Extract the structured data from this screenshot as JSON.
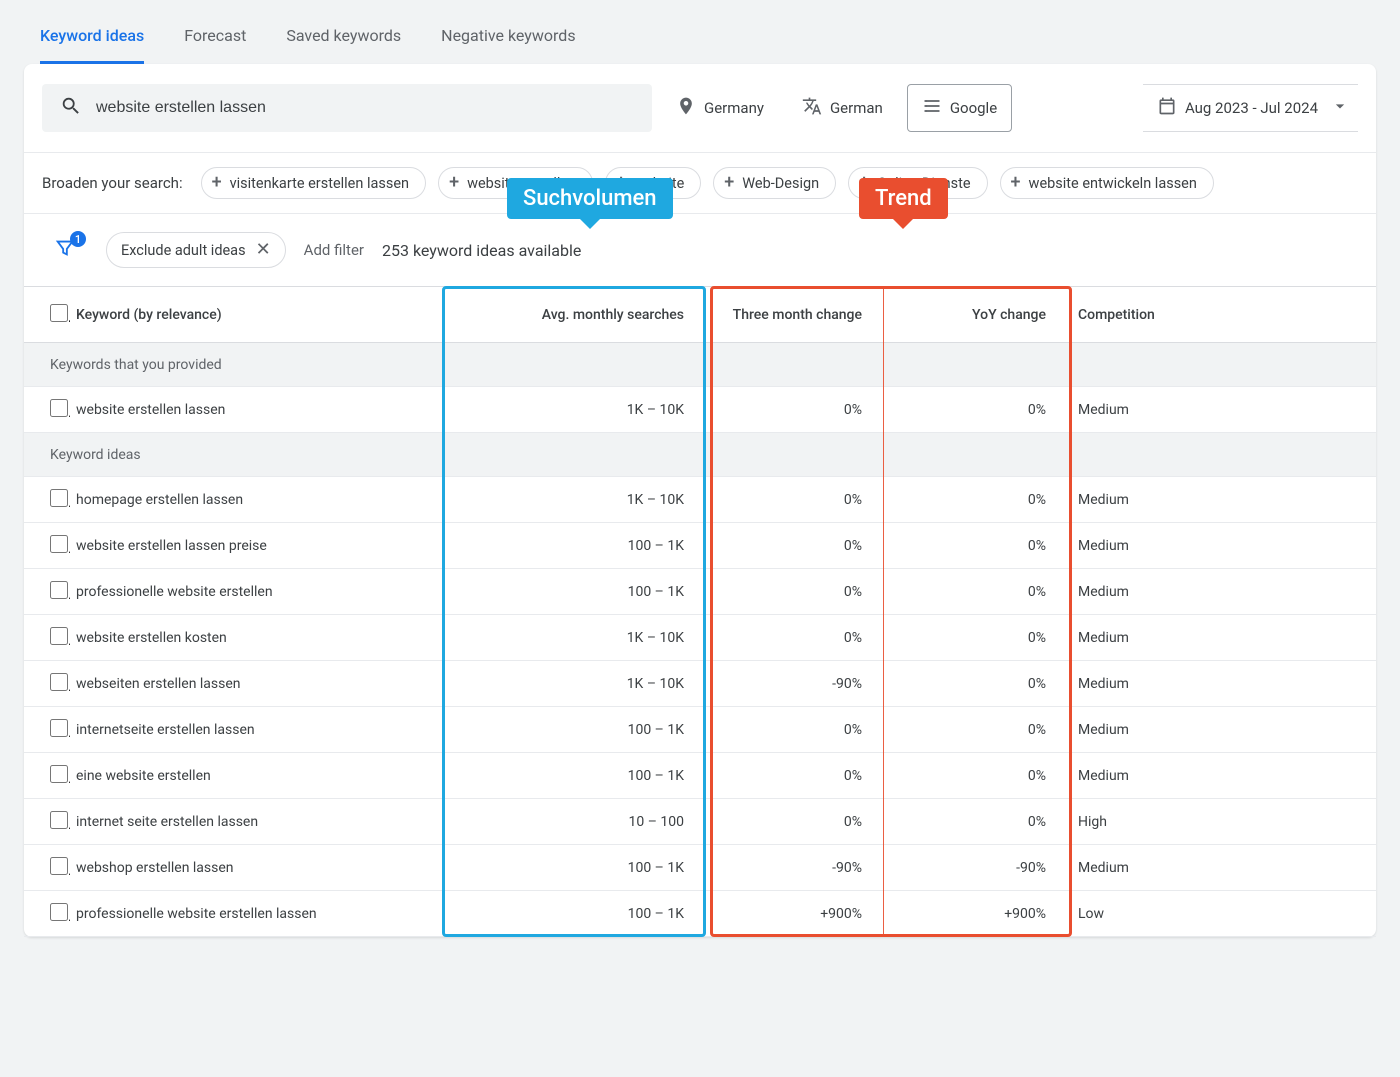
{
  "tabs": {
    "items": [
      {
        "label": "Keyword ideas",
        "active": true
      },
      {
        "label": "Forecast",
        "active": false
      },
      {
        "label": "Saved keywords",
        "active": false
      },
      {
        "label": "Negative keywords",
        "active": false
      }
    ]
  },
  "search": {
    "query": "website erstellen lassen",
    "location": "Germany",
    "language": "German",
    "network": "Google",
    "daterange": "Aug 2023 - Jul 2024"
  },
  "broaden": {
    "label": "Broaden your search:",
    "suggestions": [
      "visitenkarte erstellen lassen",
      "website erstellen",
      "website",
      "Web-Design",
      "Online-Dienste",
      "website entwickeln lassen"
    ]
  },
  "filters": {
    "badge": "1",
    "chip": "Exclude adult ideas",
    "add": "Add filter",
    "available": "253 keyword ideas available"
  },
  "annotations": {
    "volume": "Suchvolumen",
    "trend": "Trend"
  },
  "table": {
    "headers": {
      "keyword": "Keyword (by relevance)",
      "avg": "Avg. monthly searches",
      "three_mo": "Three month change",
      "yoy": "YoY change",
      "comp": "Competition"
    },
    "section_provided": "Keywords that you provided",
    "provided": [
      {
        "kw": "website erstellen lassen",
        "avg": "1K – 10K",
        "three_mo": "0%",
        "yoy": "0%",
        "comp": "Medium"
      }
    ],
    "section_ideas": "Keyword ideas",
    "ideas": [
      {
        "kw": "homepage erstellen lassen",
        "avg": "1K – 10K",
        "three_mo": "0%",
        "yoy": "0%",
        "comp": "Medium"
      },
      {
        "kw": "website erstellen lassen preise",
        "avg": "100 – 1K",
        "three_mo": "0%",
        "yoy": "0%",
        "comp": "Medium"
      },
      {
        "kw": "professionelle website erstellen",
        "avg": "100 – 1K",
        "three_mo": "0%",
        "yoy": "0%",
        "comp": "Medium"
      },
      {
        "kw": "website erstellen kosten",
        "avg": "1K – 10K",
        "three_mo": "0%",
        "yoy": "0%",
        "comp": "Medium"
      },
      {
        "kw": "webseiten erstellen lassen",
        "avg": "1K – 10K",
        "three_mo": "-90%",
        "yoy": "0%",
        "comp": "Medium"
      },
      {
        "kw": "internetseite erstellen lassen",
        "avg": "100 – 1K",
        "three_mo": "0%",
        "yoy": "0%",
        "comp": "Medium"
      },
      {
        "kw": "eine website erstellen",
        "avg": "100 – 1K",
        "three_mo": "0%",
        "yoy": "0%",
        "comp": "Medium"
      },
      {
        "kw": "internet seite erstellen lassen",
        "avg": "10 – 100",
        "three_mo": "0%",
        "yoy": "0%",
        "comp": "High"
      },
      {
        "kw": "webshop erstellen lassen",
        "avg": "100 – 1K",
        "three_mo": "-90%",
        "yoy": "-90%",
        "comp": "Medium"
      },
      {
        "kw": "professionelle website erstellen lassen",
        "avg": "100 – 1K",
        "three_mo": "+900%",
        "yoy": "+900%",
        "comp": "Low"
      }
    ]
  }
}
